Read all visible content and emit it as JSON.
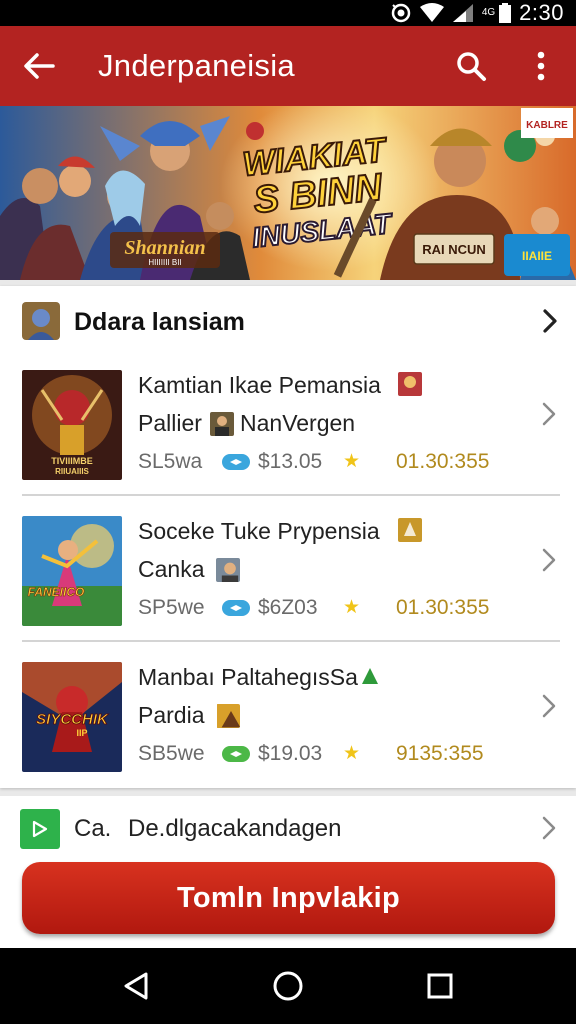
{
  "status_bar": {
    "signal_label": "4G",
    "time": "2:30"
  },
  "app_bar": {
    "title": "Jnderpaneisia",
    "back_icon": "arrow-left-icon",
    "search_icon": "search-icon",
    "menu_icon": "more-vert-icon"
  },
  "banner": {
    "logo_text": "Shannian",
    "logo_sub": "HIIIIIII BII",
    "headline_1": "WIAKIAT",
    "headline_2": "S BINN",
    "headline_3": "INUSLAAT",
    "corner_badge": "KABLRE",
    "button_text": "RAI NCUN",
    "right_badge": "IIAIIE"
  },
  "section": {
    "title": "Ddara lansiam",
    "icon": "game-avatar-icon"
  },
  "games": [
    {
      "name_line1": "Kamtian Ikae Pemansia",
      "name_line2": "Pallier",
      "name_line2b": "NanVergen",
      "code": "SL5wa",
      "price": "$13.05",
      "time": "01.30:355",
      "pill_color": "#3aa6dd",
      "thumb_text_1": "TIVIIIMBE",
      "thumb_text_2": "RIIUAIIIS"
    },
    {
      "name_line1": "Soceke Tuke Prypensia",
      "name_line2": "Canka",
      "name_line2b": "",
      "code": "SP5we",
      "price": "$6Z03",
      "time": "01.30:355",
      "pill_color": "#3aa6dd",
      "thumb_text_1": "FANEIICO",
      "thumb_text_2": ""
    },
    {
      "name_line1": "Manbaı PaltahegısSa",
      "name_line2": "Pardia",
      "name_line2b": "",
      "code": "SB5we",
      "price": "$19.03",
      "time": "9135:355",
      "pill_color": "#4cb847",
      "thumb_text_1": "SIYCCHIK",
      "thumb_text_2": "IIP"
    }
  ],
  "category": {
    "label_a": "Ca.",
    "label_b": "De.dlgacakandagen"
  },
  "cta": {
    "label": "Tomln Inpvlakip"
  },
  "nav": {
    "back": "triangle-back-icon",
    "home": "circle-home-icon",
    "recents": "square-recents-icon"
  }
}
